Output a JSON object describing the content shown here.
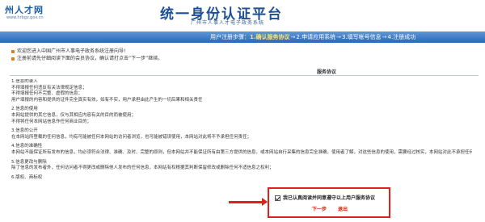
{
  "header": {
    "logo_text": "州人才网",
    "logo_url": "www.hrbgz.gov.cn",
    "title": "统一身份认证平台",
    "subtitle": "广州市人事人才电子政务系统"
  },
  "steps": {
    "prefix": "用户注册步骤：",
    "items": [
      "1.确认服务协议",
      "2.申请应用系统",
      "3.填写帐号信息",
      "4.注册成功"
    ],
    "separator": "→"
  },
  "notice": {
    "lines": [
      "欢迎您进入中国广州市人事电子政务系统注册向导!",
      "注册前请先仔细阅读下面的会员协议，确认请打点击“下一步”继续。"
    ]
  },
  "agreement": {
    "title": "服务协议",
    "paragraphs": [
      "1.信息的录入",
      "不得填报任何违反有关法律规定信息；",
      "不得填报任何不完整、虚假的信息；",
      "用户填报的内容和提供的证件完全真实有效，如有不实，用户承担由此产生的一切后果和相关责任",
      "",
      "2.信息的使用",
      "本网站提供的其它信息，仅与其相应内容有关的目的而被使用；",
      "不得将任何本网站信息作任何商业目的；",
      "",
      "3.信息的公开",
      "在本网站所登载的任何信息，均有可能被任何本网站的访问者浏览，也可能被错误使用，本网站对此将不予承担任何责任；",
      "",
      "4.信息的准确性",
      "本网站不能保证所有发布的信息，均必须符合法律、准确、及时、完整的原则，但本网站并不能保证所有由第三方提供的信息，或本网站自行采集的信息完全准确，使用者了解，对这些信息的使用，需要经过核实，本网站对此不承担任何责任；",
      "",
      "5.信息更改与删除",
      "除了信息的发布者外，任何访问者不得更改或删除他人发布的任何信息，本网站有权根据其判断保留修改或删除任何不适信息之权利；",
      "",
      "6.版权、商标权"
    ]
  },
  "accept": {
    "label": "我已认真阅读并同意遵守以上用户服务协议",
    "checked": true
  },
  "buttons": {
    "next": "下一步",
    "exit": "退出"
  },
  "colors": {
    "brand_blue": "#1c4f95",
    "step_bar": "#2f6fc0",
    "current_step": "#ffe66a",
    "action_red": "#cc2200",
    "highlight": "#e0201a"
  }
}
